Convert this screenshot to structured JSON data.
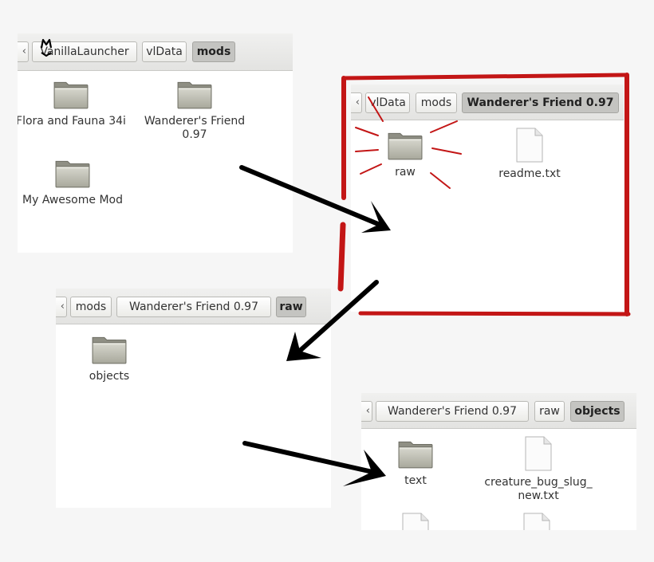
{
  "panel1": {
    "crumbs": [
      "VanillaLauncher",
      "vlData",
      "mods"
    ],
    "items": [
      "Flora and Fauna 34i",
      "Wanderer's Friend 0.97",
      "My Awesome Mod"
    ]
  },
  "panel2": {
    "crumbs": [
      "vlData",
      "mods",
      "Wanderer's Friend 0.97"
    ],
    "items": [
      "raw",
      "readme.txt"
    ]
  },
  "panel3": {
    "crumbs": [
      "mods",
      "Wanderer's Friend 0.97",
      "raw"
    ],
    "items": [
      "objects"
    ]
  },
  "panel4": {
    "crumbs": [
      "Wanderer's Friend 0.97",
      "raw",
      "objects"
    ],
    "items": [
      "text",
      "creature_bug_slug_\nnew.txt"
    ]
  },
  "icons": {
    "folder": "folder-icon",
    "file": "text-file-icon",
    "nav_left": "chevron-left-icon"
  },
  "colors": {
    "highlight": "#cc1a1a",
    "arrow": "#000000",
    "folder": "#b5b5a8"
  }
}
